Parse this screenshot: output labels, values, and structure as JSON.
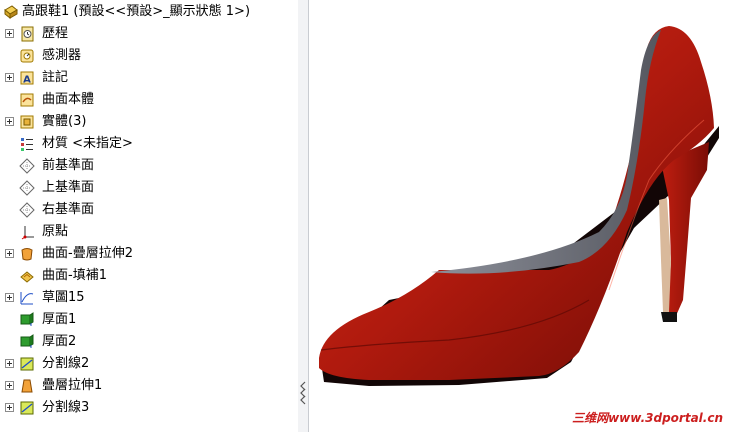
{
  "tree": {
    "root_label": "高跟鞋1  (預設<<預設>_顯示狀態 1>)",
    "items": [
      {
        "label": "歷程",
        "icon": "history-icon",
        "expandable": true
      },
      {
        "label": "感測器",
        "icon": "sensor-icon",
        "expandable": false
      },
      {
        "label": "註記",
        "icon": "annotation-icon",
        "expandable": true
      },
      {
        "label": "曲面本體",
        "icon": "surface-body-icon",
        "expandable": false
      },
      {
        "label": "實體(3)",
        "icon": "solid-body-icon",
        "expandable": true
      },
      {
        "label": "材質 <未指定>",
        "icon": "material-icon",
        "expandable": false
      },
      {
        "label": "前基準面",
        "icon": "plane-icon",
        "expandable": false
      },
      {
        "label": "上基準面",
        "icon": "plane-icon",
        "expandable": false
      },
      {
        "label": "右基準面",
        "icon": "plane-icon",
        "expandable": false
      },
      {
        "label": "原點",
        "icon": "origin-icon",
        "expandable": false
      },
      {
        "label": "曲面-疊層拉伸2",
        "icon": "surface-loft-icon",
        "expandable": true
      },
      {
        "label": "曲面-填補1",
        "icon": "surface-fill-icon",
        "expandable": false
      },
      {
        "label": "草圖15",
        "icon": "sketch-icon",
        "expandable": true
      },
      {
        "label": "厚面1",
        "icon": "thicken-icon",
        "expandable": false
      },
      {
        "label": "厚面2",
        "icon": "thicken-icon",
        "expandable": false
      },
      {
        "label": "分割線2",
        "icon": "split-line-icon",
        "expandable": true
      },
      {
        "label": "疊層拉伸1",
        "icon": "loft-icon",
        "expandable": true
      },
      {
        "label": "分割線3",
        "icon": "split-line-icon",
        "expandable": true
      }
    ]
  },
  "viewport": {
    "model": "red high heel shoe",
    "watermark": "三维网www.3dportal.cn"
  },
  "colors": {
    "shoe_red": "#b01a0e",
    "shoe_inner": "#6d6f7a",
    "heel_tan": "#d9b99b",
    "watermark_red": "#cc1f1f"
  }
}
